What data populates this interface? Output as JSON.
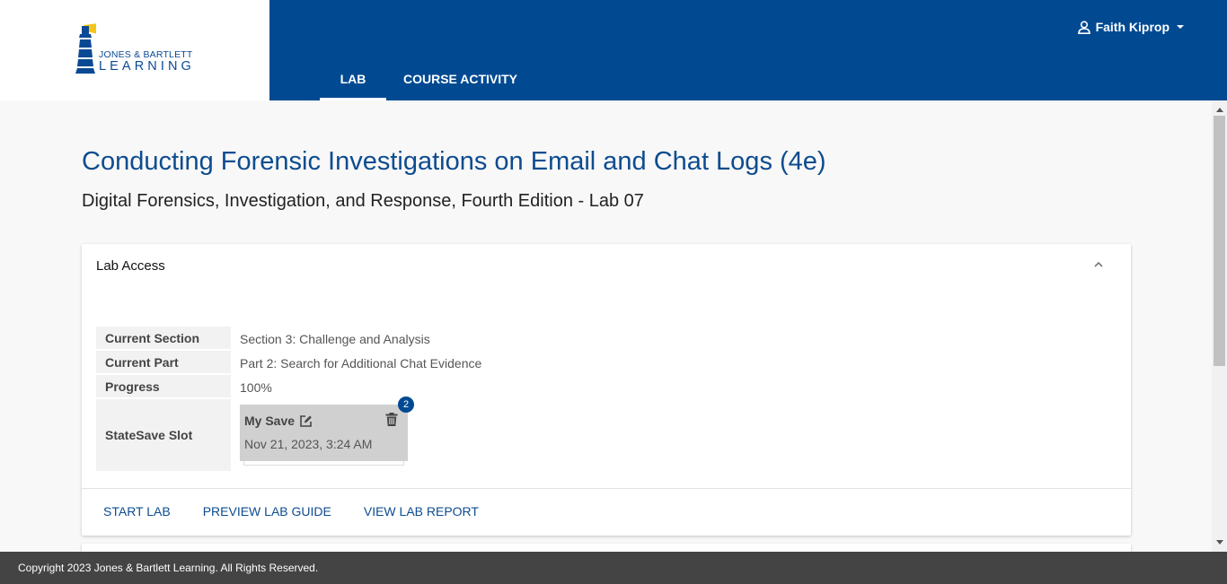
{
  "brand": {
    "line1": "JONES & BARTLETT",
    "line2": "LEARNING",
    "lighthouse_color": "#0a4a94",
    "light_color": "#f5c518"
  },
  "nav": {
    "tabs": [
      {
        "label": "LAB",
        "active": true
      },
      {
        "label": "COURSE ACTIVITY",
        "active": false
      }
    ],
    "user_name": "Faith Kiprop",
    "bg_color": "#014a92"
  },
  "page": {
    "title": "Conducting Forensic Investigations on Email and Chat Logs (4e)",
    "subtitle": "Digital Forensics, Investigation, and Response, Fourth Edition - Lab 07"
  },
  "lab_access": {
    "title": "Lab Access",
    "rows": [
      {
        "label": "Current Section",
        "value": "Section 3: Challenge and Analysis"
      },
      {
        "label": "Current Part",
        "value": "Part 2: Search for Additional Chat Evidence"
      },
      {
        "label": "Progress",
        "value": "100%"
      }
    ],
    "statesave": {
      "label": "StateSave Slot",
      "slot_name": "My Save",
      "slot_date": "Nov 21, 2023, 3:24 AM",
      "badge": "2"
    },
    "actions": [
      {
        "label": "START LAB"
      },
      {
        "label": "PREVIEW LAB GUIDE"
      },
      {
        "label": "VIEW LAB REPORT"
      }
    ]
  },
  "footer": {
    "text": "Copyright 2023 Jones & Bartlett Learning. All Rights Reserved."
  }
}
